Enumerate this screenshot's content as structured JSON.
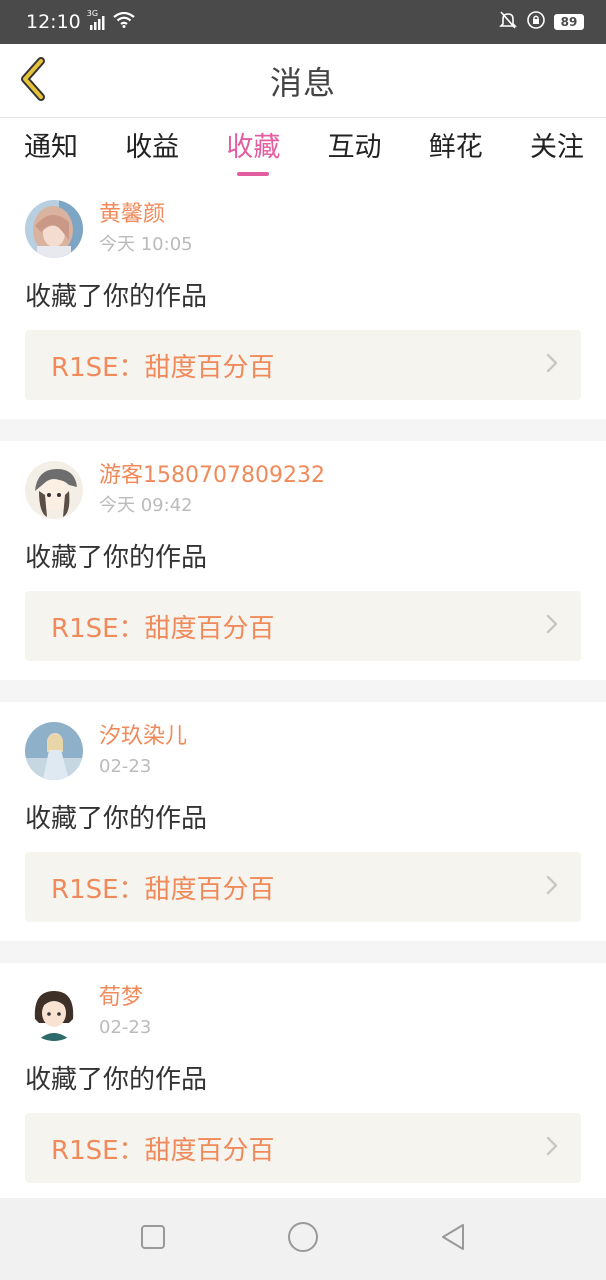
{
  "status_bar": {
    "time": "12:10",
    "network": "3G",
    "battery": "89"
  },
  "header": {
    "title": "消息"
  },
  "tabs": [
    {
      "label": "通知"
    },
    {
      "label": "收益"
    },
    {
      "label": "收藏",
      "active": true
    },
    {
      "label": "互动"
    },
    {
      "label": "鲜花"
    },
    {
      "label": "关注"
    }
  ],
  "messages": [
    {
      "username": "黄馨颜",
      "time": "今天 10:05",
      "action": "收藏了你的作品",
      "work_title": "R1SE：甜度百分百",
      "avatar": "avatar-girl-photo"
    },
    {
      "username": "游客1580707809232",
      "time": "今天 09:42",
      "action": "收藏了你的作品",
      "work_title": "R1SE：甜度百分百",
      "avatar": "avatar-cartoon-girl-cap"
    },
    {
      "username": "汐玖染儿",
      "time": "02-23",
      "action": "收藏了你的作品",
      "work_title": "R1SE：甜度百分百",
      "avatar": "avatar-girl-blue-dress"
    },
    {
      "username": "荀梦",
      "time": "02-23",
      "action": "收藏了你的作品",
      "work_title": "R1SE：甜度百分百",
      "avatar": "avatar-cartoon-girl-bob"
    }
  ],
  "colors": {
    "accent": "#e25ea0",
    "link_orange": "#f08a5a",
    "back_arrow": "#e6c23a"
  },
  "icons": {
    "back": "chevron-left-icon",
    "link_chevron": "chevron-right-icon",
    "nav_recent": "square-icon",
    "nav_home": "circle-icon",
    "nav_back": "triangle-back-icon"
  }
}
